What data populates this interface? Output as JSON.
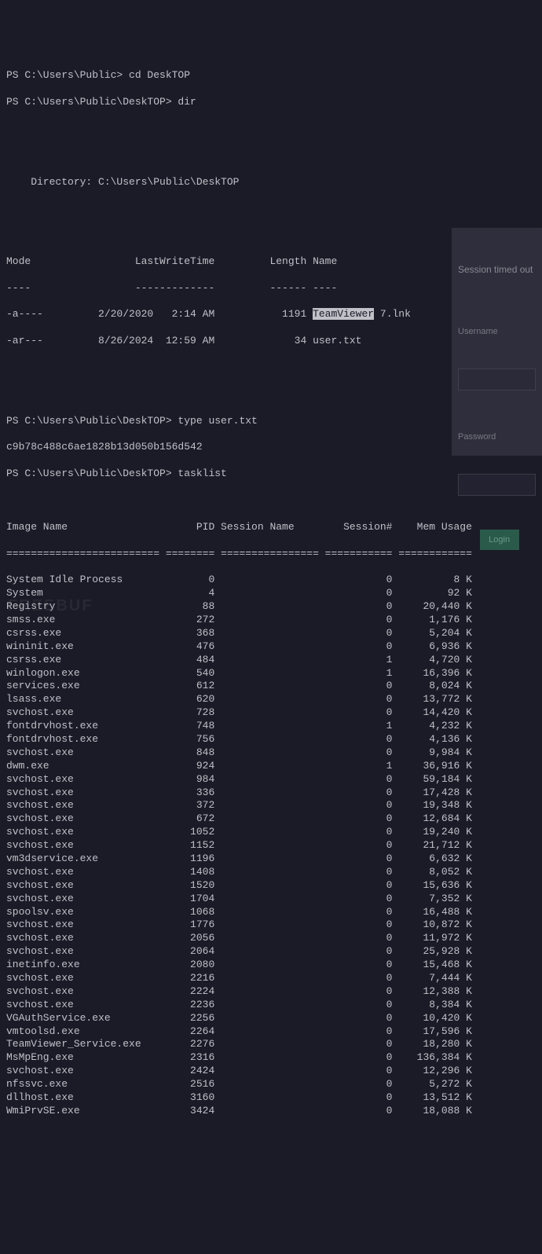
{
  "prompts": {
    "cd": "PS C:\\Users\\Public> cd DeskTOP",
    "dir": "PS C:\\Users\\Public\\DeskTOP> dir",
    "type": "PS C:\\Users\\Public\\DeskTOP> type user.txt",
    "tasklist": "PS C:\\Users\\Public\\DeskTOP> tasklist"
  },
  "directory": {
    "header": "    Directory: C:\\Users\\Public\\DeskTOP",
    "columns": "Mode                 LastWriteTime         Length Name",
    "divider": "----                 -------------         ------ ----",
    "row1_a": "-a----         2/20/2020   2:14 AM           1191 ",
    "row1_hl": "TeamViewer",
    "row1_b": " 7.lnk",
    "row2": "-ar---         8/26/2024  12:59 AM             34 user.txt"
  },
  "usertxt": "c9b78c488c6ae1828b13d050b156d542",
  "tasklist": {
    "header": "Image Name                     PID Session Name        Session#    Mem Usage",
    "divider": "========================= ======== ================ =========== ============",
    "rows": [
      "System Idle Process              0                            0          8 K",
      "System                           4                            0         92 K",
      "Registry                        88                            0     20,440 K",
      "smss.exe                       272                            0      1,176 K",
      "csrss.exe                      368                            0      5,204 K",
      "wininit.exe                    476                            0      6,936 K",
      "csrss.exe                      484                            1      4,720 K",
      "winlogon.exe                   540                            1     16,396 K",
      "services.exe                   612                            0      8,024 K",
      "lsass.exe                      620                            0     13,772 K",
      "svchost.exe                    728                            0     14,420 K",
      "fontdrvhost.exe                748                            1      4,232 K",
      "fontdrvhost.exe                756                            0      4,136 K",
      "svchost.exe                    848                            0      9,984 K",
      "dwm.exe                        924                            1     36,916 K",
      "svchost.exe                    984                            0     59,184 K",
      "svchost.exe                    336                            0     17,428 K",
      "svchost.exe                    372                            0     19,348 K",
      "svchost.exe                    672                            0     12,684 K",
      "svchost.exe                   1052                            0     19,240 K",
      "svchost.exe                   1152                            0     21,712 K",
      "vm3dservice.exe               1196                            0      6,632 K",
      "svchost.exe                   1408                            0      8,052 K",
      "svchost.exe                   1520                            0     15,636 K",
      "svchost.exe                   1704                            0      7,352 K",
      "spoolsv.exe                   1068                            0     16,488 K",
      "svchost.exe                   1776                            0     10,872 K",
      "svchost.exe                   2056                            0     11,972 K",
      "svchost.exe                   2064                            0     25,928 K",
      "inetinfo.exe                  2080                            0     15,468 K",
      "svchost.exe                   2216                            0      7,444 K",
      "svchost.exe                   2224                            0     12,388 K",
      "svchost.exe                   2236                            0      8,384 K",
      "VGAuthService.exe             2256                            0     10,420 K",
      "vmtoolsd.exe                  2264                            0     17,596 K",
      "TeamViewer_Service.exe        2276                            0     18,280 K",
      "MsMpEng.exe                   2316                            0    136,384 K",
      "svchost.exe                   2424                            0     12,296 K",
      "nfssvc.exe                    2516                            0      5,272 K",
      "dllhost.exe                   3160                            0     13,512 K",
      "WmiPrvSE.exe                  3424                            0     18,088 K"
    ]
  },
  "overlay": {
    "title": "Session timed out",
    "username_label": "Username",
    "password_label": "Password",
    "login_button": "Login"
  },
  "watermark": "FREEBUF"
}
